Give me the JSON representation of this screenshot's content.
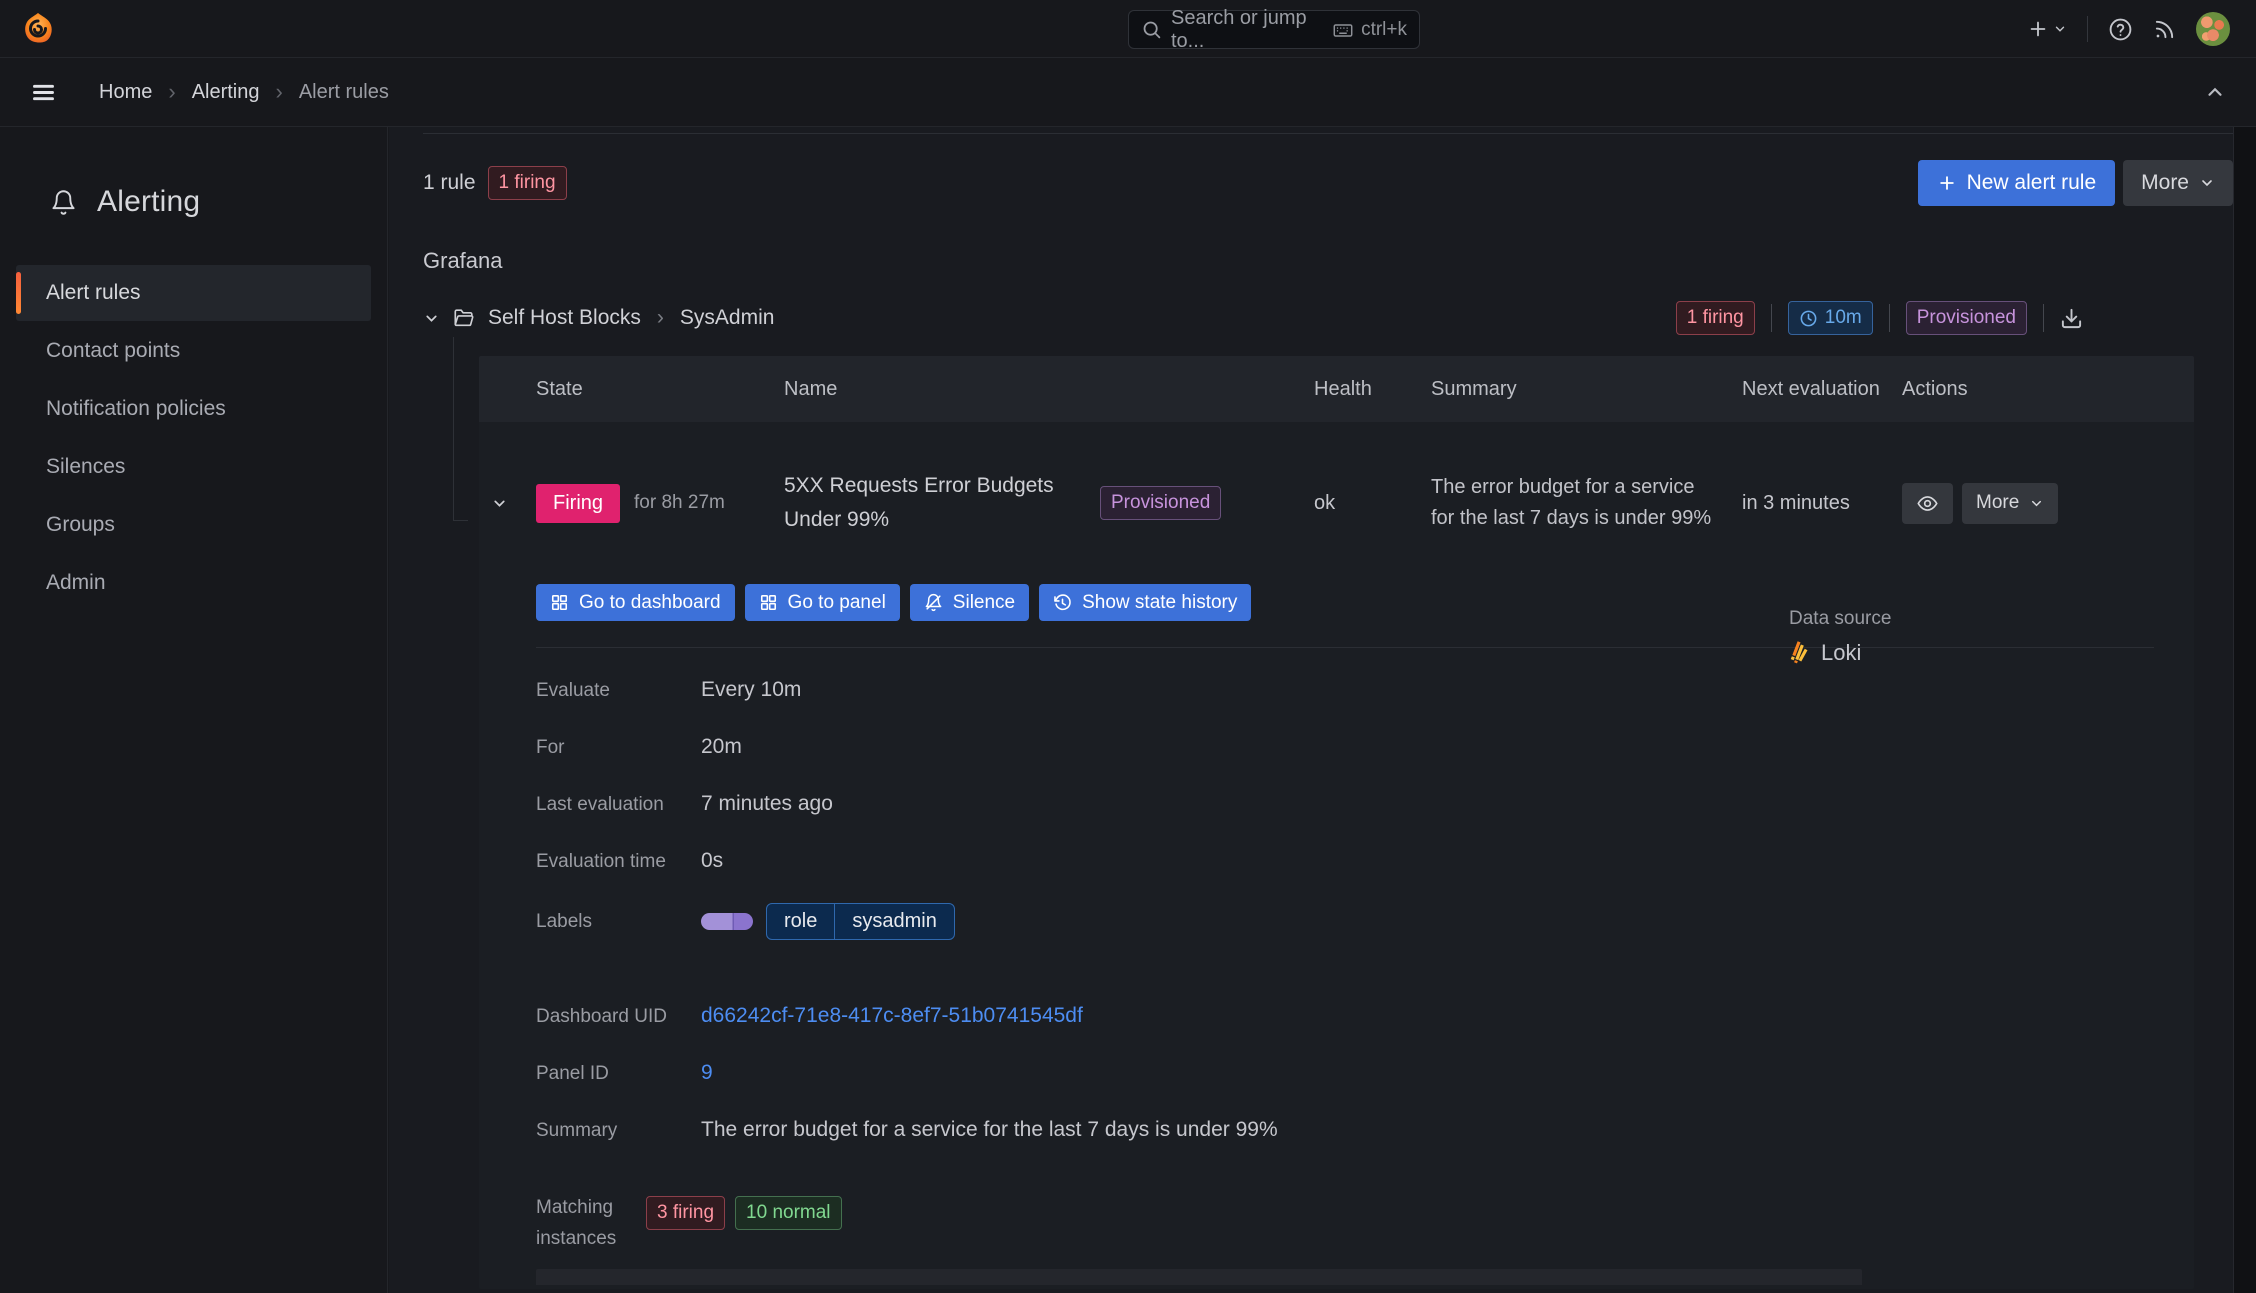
{
  "topbar": {
    "search_placeholder": "Search or jump to...",
    "shortcut": "ctrl+k"
  },
  "breadcrumb": {
    "items": [
      "Home",
      "Alerting",
      "Alert rules"
    ],
    "separator": "›"
  },
  "sidebar": {
    "title": "Alerting",
    "items": [
      {
        "label": "Alert rules",
        "active": true
      },
      {
        "label": "Contact points",
        "active": false
      },
      {
        "label": "Notification policies",
        "active": false
      },
      {
        "label": "Silences",
        "active": false
      },
      {
        "label": "Groups",
        "active": false
      },
      {
        "label": "Admin",
        "active": false
      }
    ]
  },
  "toolbar": {
    "rule_count": "1 rule",
    "firing_badge": "1 firing",
    "new_alert_rule_label": "New alert rule",
    "more_label": "More"
  },
  "section_title": "Grafana",
  "folder": {
    "name": "Self Host Blocks",
    "group": "SysAdmin",
    "separator": "›",
    "firing_badge": "1 firing",
    "interval_badge": "10m",
    "provisioned_badge": "Provisioned"
  },
  "table": {
    "headers": [
      "State",
      "Name",
      "Health",
      "Summary",
      "Next evaluation",
      "Actions"
    ]
  },
  "rule": {
    "state": "Firing",
    "duration": "for 8h 27m",
    "name": "5XX Requests Error Budgets Under 99%",
    "provisioned_badge": "Provisioned",
    "health": "ok",
    "summary": "The error budget for a service for the last 7 days is under 99%",
    "next_evaluation": "in 3 minutes",
    "more_label": "More"
  },
  "rule_actions": {
    "go_to_dashboard": "Go to dashboard",
    "go_to_panel": "Go to panel",
    "silence": "Silence",
    "show_state_history": "Show state history"
  },
  "details": {
    "evaluate_label": "Evaluate",
    "evaluate_value": "Every 10m",
    "for_label": "For",
    "for_value": "20m",
    "last_evaluation_label": "Last evaluation",
    "last_evaluation_value": "7 minutes ago",
    "evaluation_time_label": "Evaluation time",
    "evaluation_time_value": "0s",
    "labels_label": "Labels",
    "label_key": "role",
    "label_value": "sysadmin",
    "datasource_label": "Data source",
    "datasource_value": "Loki",
    "dashboard_uid_label": "Dashboard UID",
    "dashboard_uid_value": "d66242cf-71e8-417c-8ef7-51b0741545df",
    "panel_id_label": "Panel ID",
    "panel_id_value": "9",
    "summary_label": "Summary",
    "summary_value": "The error budget for a service for the last 7 days is under 99%",
    "matching_instances_label": "Matching instances",
    "firing_count_badge": "3 firing",
    "normal_count_badge": "10 normal"
  },
  "colors": {
    "accent_blue": "#3D71D9",
    "firing_pink": "#E0226E",
    "error_red": "#FF95A2",
    "success_green": "#81D890",
    "provisioned_purple": "#C793DC",
    "interval_blue": "#68A9E9",
    "link_blue": "#4D8DF2",
    "active_orange": "#FF8833",
    "background": "#17181C"
  }
}
